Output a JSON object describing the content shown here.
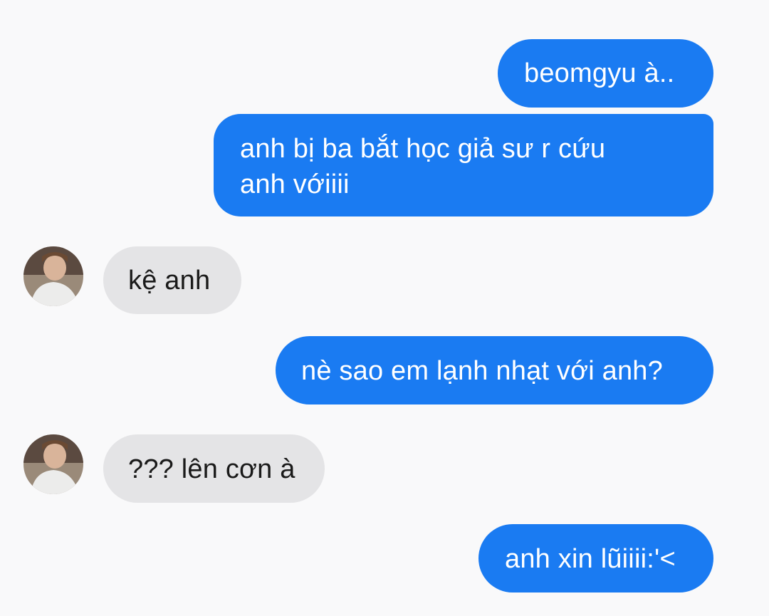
{
  "conversation": {
    "messages": [
      {
        "sender": "me",
        "text": "beomgyu à.."
      },
      {
        "sender": "me",
        "text": "anh bị ba bắt học giả sư r cứu\nanh vớiiii"
      },
      {
        "sender": "contact",
        "text": "kệ anh"
      },
      {
        "sender": "me",
        "text": "nè sao em lạnh nhạt với anh?"
      },
      {
        "sender": "contact",
        "text": "??? lên cơn à"
      },
      {
        "sender": "me",
        "text": "anh xin lũiiii:'<"
      }
    ]
  },
  "colors": {
    "outgoing_bubble": "#1a7bf2",
    "incoming_bubble": "#e4e4e6",
    "background": "#f9f9fa"
  },
  "icons": {
    "contact_avatar": "contact-avatar-photo"
  }
}
